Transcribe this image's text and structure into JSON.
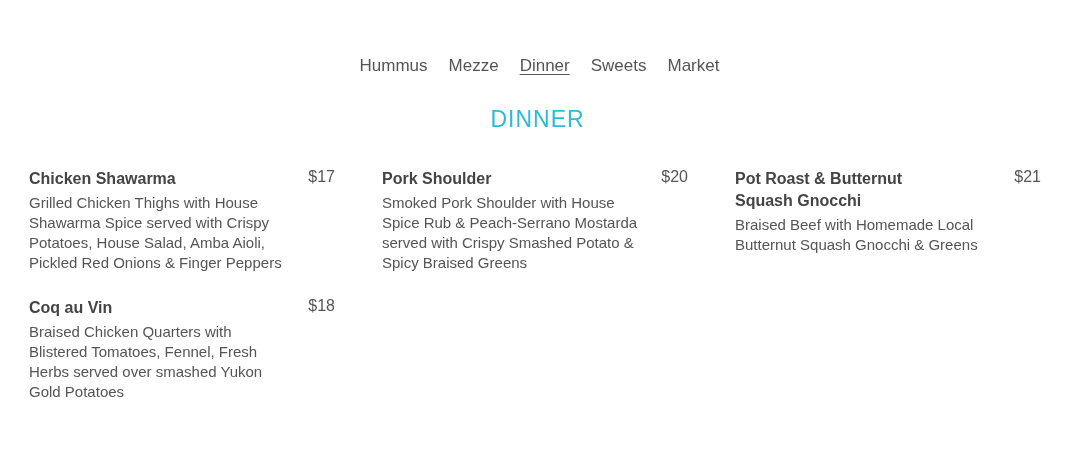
{
  "nav": [
    {
      "label": "Hummus",
      "selected": false
    },
    {
      "label": "Mezze",
      "selected": false
    },
    {
      "label": "Dinner",
      "selected": true
    },
    {
      "label": "Sweets",
      "selected": false
    },
    {
      "label": "Market",
      "selected": false
    }
  ],
  "section_title": "DINNER",
  "items": [
    {
      "name": "Chicken Shawarma",
      "price": "$17",
      "description": "Grilled Chicken Thighs with House Shawarma Spice served with Crispy Potatoes, House Salad, Amba Aioli, Pickled Red Onions & Finger Peppers"
    },
    {
      "name": "Pork Shoulder",
      "price": "$20",
      "description": "Smoked Pork Shoulder with House Spice Rub & Peach-Serrano Mostarda served with Crispy Smashed Potato & Spicy Braised Greens"
    },
    {
      "name": "Pot Roast & Butternut Squash Gnocchi",
      "price": "$21",
      "description": "Braised Beef with Homemade Local Butternut Squash Gnocchi & Greens"
    },
    {
      "name": "Coq au Vin",
      "price": "$18",
      "description": "Braised Chicken Quarters with Blistered Tomatoes, Fennel, Fresh Herbs served over smashed Yukon Gold Potatoes"
    }
  ]
}
